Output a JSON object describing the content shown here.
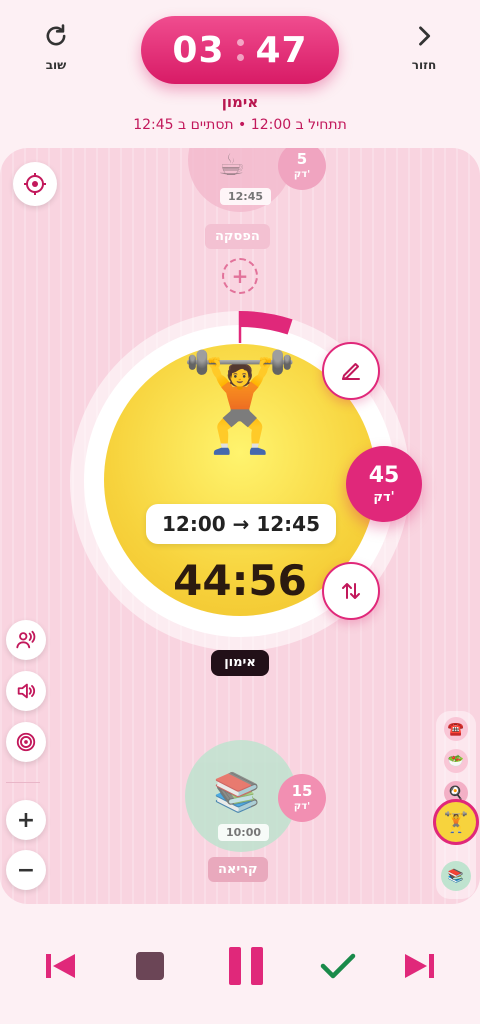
{
  "header": {
    "back_label": "חזור",
    "undo_label": "שוב",
    "clock_hours": "03",
    "clock_minutes": "47",
    "title": "אימון",
    "subtitle": "תתחיל ב 12:00 • תסתיים ב 12:45"
  },
  "previous_task": {
    "emoji": "☕",
    "time": "12:45",
    "duration": "5",
    "duration_unit": "דק'",
    "label": "הפסקה"
  },
  "current_task": {
    "emoji": "🏋️",
    "time_range": "12:00 → 12:45",
    "countdown": "44:56",
    "duration": "45",
    "duration_unit": "דק'",
    "name": "אימון",
    "progress_percent": 5
  },
  "next_task": {
    "emoji": "📚",
    "time": "10:00",
    "duration": "15",
    "duration_unit": "דק'",
    "label": "קריאה"
  },
  "left_tools": {
    "zoom_in": "+",
    "zoom_out": "−"
  },
  "mini_rail": [
    {
      "emoji": "☎️"
    },
    {
      "emoji": "🥗"
    },
    {
      "emoji": "🍳"
    },
    {
      "emoji": "🏋️"
    },
    {
      "emoji": "📚"
    }
  ],
  "colors": {
    "accent": "#e0287a",
    "timeline_bg": "#f9d4e0",
    "current_disc": "#f7d33d",
    "next_disc": "#bfe3cf",
    "stop_button": "#6b4556",
    "done_check": "#1a8a4a"
  }
}
